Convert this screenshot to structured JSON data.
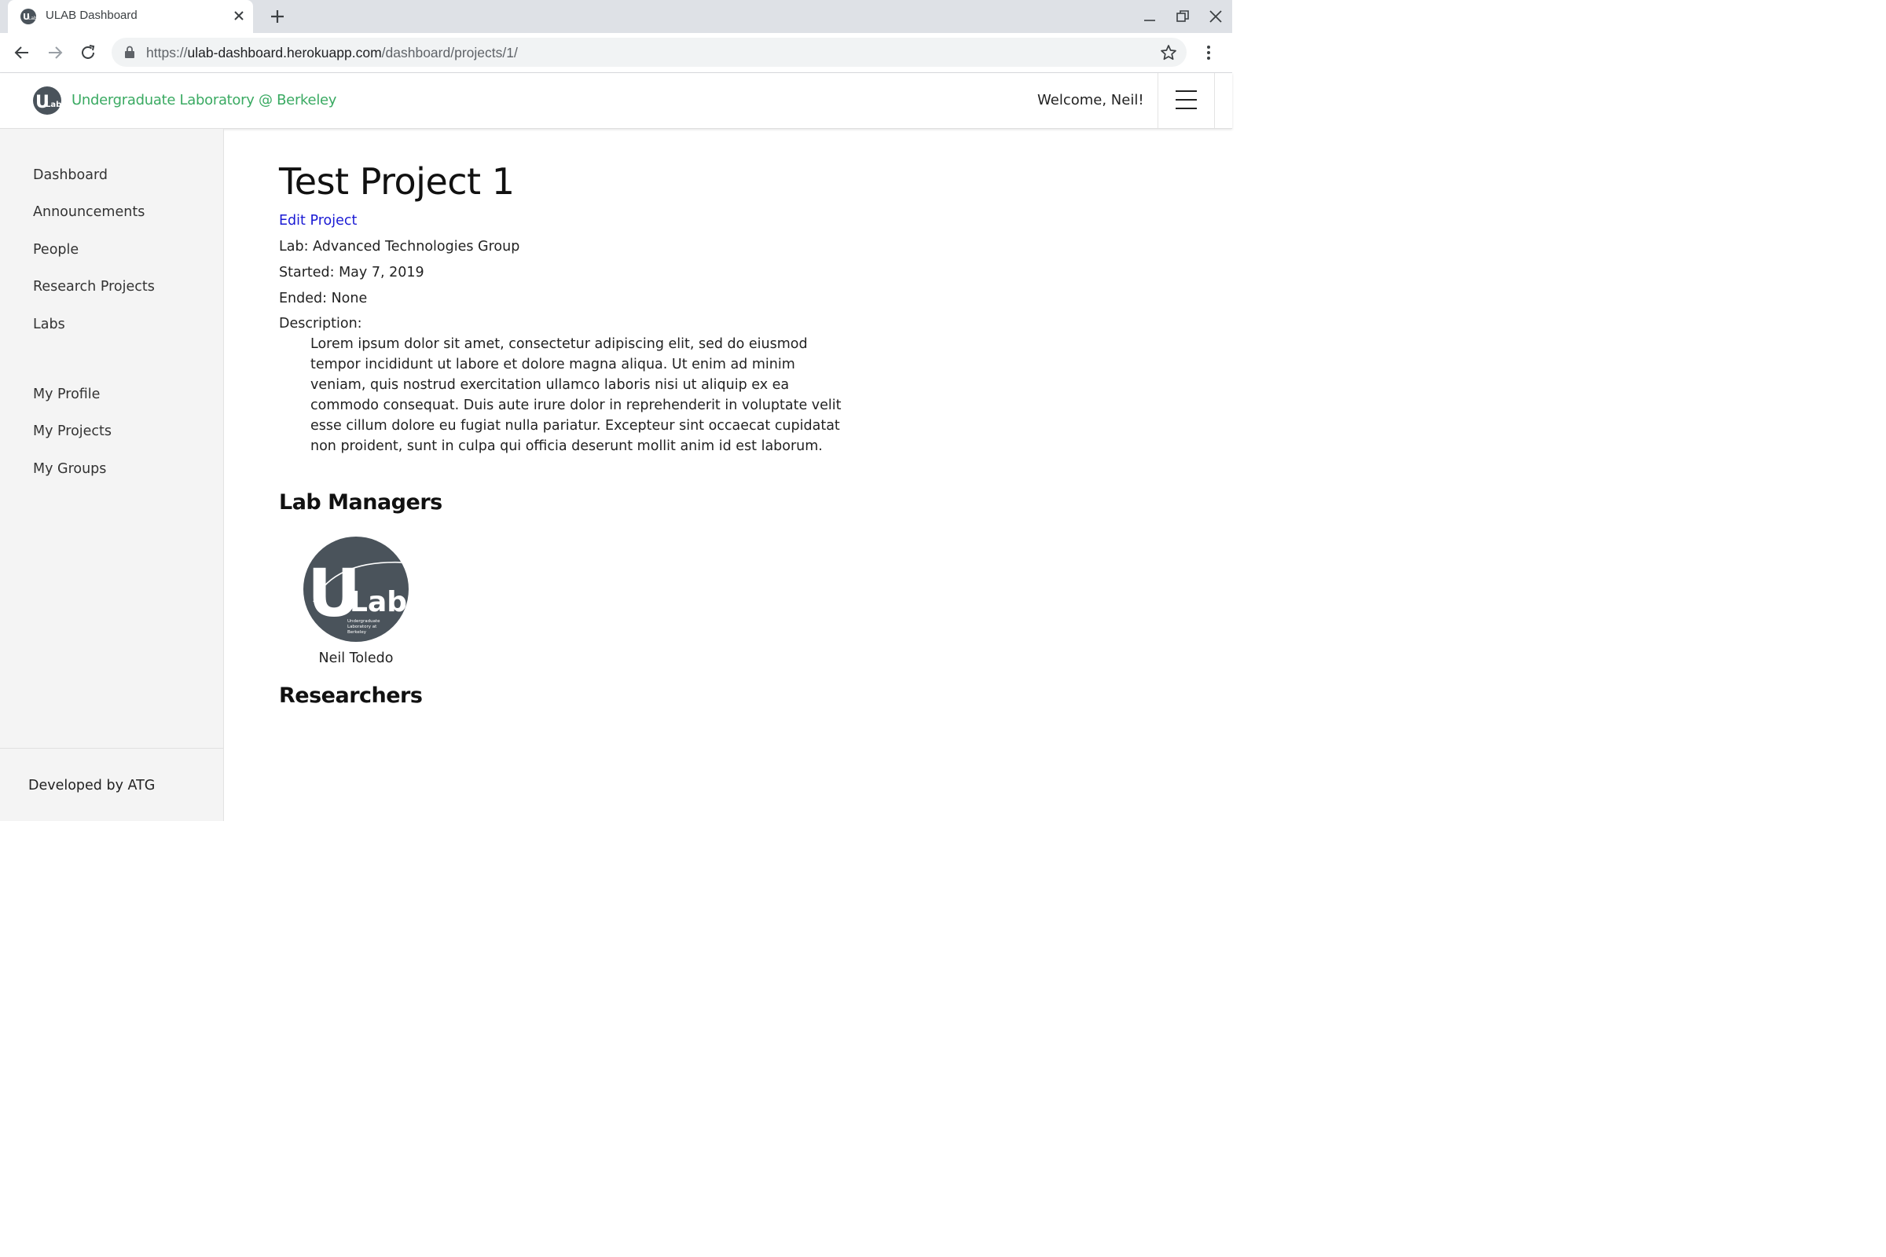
{
  "browser": {
    "tab_title": "ULAB Dashboard",
    "url_scheme": "https://",
    "url_host": "ulab-dashboard.herokuapp.com",
    "url_path": "/dashboard/projects/1/"
  },
  "header": {
    "brand_name": "Undergraduate Laboratory @ Berkeley",
    "welcome": "Welcome, Neil!",
    "brand_color": "#3aaa62"
  },
  "logo": {
    "text_u": "U",
    "text_lab": "Lab",
    "small_text": [
      "Undergraduate",
      "Laboratory at",
      "Berkeley"
    ],
    "color": "#4a535b"
  },
  "sidebar": {
    "items": [
      {
        "label": "Dashboard"
      },
      {
        "label": "Announcements"
      },
      {
        "label": "People"
      },
      {
        "label": "Research Projects"
      },
      {
        "label": "Labs"
      }
    ],
    "personal_items": [
      {
        "label": "My Profile"
      },
      {
        "label": "My Projects"
      },
      {
        "label": "My Groups"
      }
    ],
    "footer": "Developed by ATG"
  },
  "project": {
    "title": "Test Project 1",
    "edit_label": "Edit Project",
    "lab": "Lab: Advanced Technologies Group",
    "started": "Started: May 7, 2019",
    "ended": "Ended: None",
    "description_label": "Description:",
    "description": "Lorem ipsum dolor sit amet, consectetur adipiscing elit, sed do eiusmod tempor incididunt ut labore et dolore magna aliqua. Ut enim ad minim veniam, quis nostrud exercitation ullamco laboris nisi ut aliquip ex ea commodo consequat. Duis aute irure dolor in reprehenderit in voluptate velit esse cillum dolore eu fugiat nulla pariatur. Excepteur sint occaecat cupidatat non proident, sunt in culpa qui officia deserunt mollit anim id est laborum."
  },
  "sections": {
    "lab_managers": "Lab Managers",
    "researchers": "Researchers"
  },
  "lab_managers": [
    {
      "name": "Neil Toledo"
    }
  ]
}
